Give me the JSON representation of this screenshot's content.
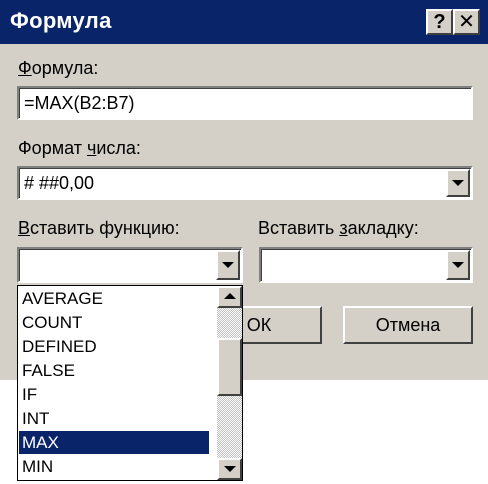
{
  "dialog": {
    "title": "Формула",
    "help_btn": "?",
    "close_btn": "✕"
  },
  "formula": {
    "label_ul": "Ф",
    "label_rest": "ормула:",
    "value": "=MAX(B2:B7)"
  },
  "number_format": {
    "label_a": "Формат ",
    "label_ul": "ч",
    "label_b": "исла:",
    "value": "# ##0,00"
  },
  "insert_function": {
    "label_ul": "В",
    "label_rest": "ставить функцию:",
    "value": ""
  },
  "insert_bookmark": {
    "label_a": "Вставить ",
    "label_ul": "з",
    "label_b": "акладку:",
    "value": ""
  },
  "buttons": {
    "ok": "ОК",
    "cancel": "Отмена"
  },
  "function_list": {
    "items": [
      "AVERAGE",
      "COUNT",
      "DEFINED",
      "FALSE",
      "IF",
      "INT",
      "MAX",
      "MIN"
    ],
    "selected": "MAX"
  },
  "colors": {
    "title_bar": "#0a246a",
    "dialog_face": "#d4d0c8",
    "selection": "#0a246a"
  }
}
